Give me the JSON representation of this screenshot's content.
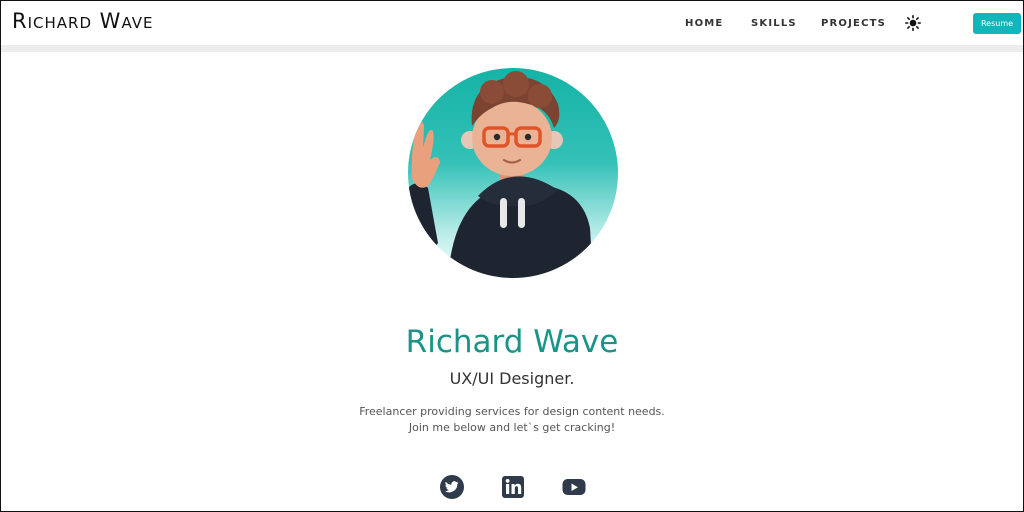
{
  "header": {
    "logo": "Richard Wave",
    "nav": [
      "HOME",
      "SKILLS",
      "PROJECTS"
    ],
    "theme_icon": "sun-icon",
    "resume_label": "Resume"
  },
  "hero": {
    "name": "Richard Wave",
    "role": "UX/UI Designer.",
    "description_line1": "Freelancer providing services for design content needs.",
    "description_line2": "Join me below and let`s get cracking!"
  },
  "social": [
    {
      "name": "twitter-icon"
    },
    {
      "name": "linkedin-icon"
    },
    {
      "name": "youtube-icon"
    }
  ],
  "colors": {
    "accent": "#11b6ba",
    "name": "#1b9488",
    "icon": "#2f3b4a"
  }
}
